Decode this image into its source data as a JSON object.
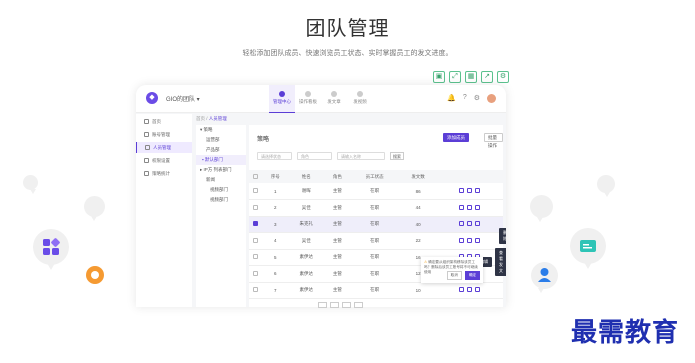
{
  "hero": {
    "title": "团队管理",
    "subtitle": "轻松添加团队成员、快速浏览员工状态、实时掌握员工的发文进度。"
  },
  "toolstrip": [
    "save-icon",
    "expand-icon",
    "grid-icon",
    "share-icon",
    "settings-icon"
  ],
  "app": {
    "org_name": "GIO的团队",
    "tabs": [
      {
        "label": "管理中心",
        "active": true
      },
      {
        "label": "操作看板",
        "active": false
      },
      {
        "label": "发文章",
        "active": false
      },
      {
        "label": "发视频",
        "active": false
      }
    ],
    "sidebar": [
      {
        "label": "首页",
        "active": false
      },
      {
        "label": "账号管理",
        "active": false
      },
      {
        "label": "人员管理",
        "active": true
      },
      {
        "label": "权限设置",
        "active": false
      },
      {
        "label": "策略统计",
        "active": false
      }
    ],
    "breadcrumb": {
      "root": "首页",
      "current": "人员管理"
    },
    "tree": [
      {
        "label": "策略",
        "active": false
      },
      {
        "label": "运营部",
        "active": false
      },
      {
        "label": "产品部",
        "active": false
      },
      {
        "label": "默认部门",
        "active": true
      },
      {
        "label": "IP方 列表部门",
        "active": false
      },
      {
        "label": "新闻",
        "active": false
      },
      {
        "label": "视频部门",
        "active": false
      },
      {
        "label": "视频部门",
        "active": false
      }
    ],
    "main_title": "策略",
    "add_button": "添加成员",
    "more_button": "批量操作",
    "filters": {
      "sel1": "请选择状态",
      "sel2": "角色",
      "search": "请输入名称",
      "search_button": "搜索"
    },
    "columns": [
      "序号",
      "姓名",
      "角色",
      "员工状态",
      "发文数"
    ],
    "rows": [
      {
        "num": "1",
        "name": "谢晖",
        "role": "主管",
        "status": "在职",
        "posts": "86",
        "selected": false
      },
      {
        "num": "2",
        "name": "吴佳",
        "role": "主管",
        "status": "在职",
        "posts": "44",
        "selected": false
      },
      {
        "num": "3",
        "name": "朱克礼",
        "role": "主管",
        "status": "在职",
        "posts": "40",
        "selected": true
      },
      {
        "num": "4",
        "name": "吴佳",
        "role": "主管",
        "status": "在职",
        "posts": "22",
        "selected": false
      },
      {
        "num": "5",
        "name": "素伊达",
        "role": "主管",
        "status": "在职",
        "posts": "16",
        "selected": false
      },
      {
        "num": "6",
        "name": "素伊达",
        "role": "主管",
        "status": "在职",
        "posts": "12",
        "selected": false
      },
      {
        "num": "7",
        "name": "素伊达",
        "role": "主管",
        "status": "在职",
        "posts": "10",
        "selected": false
      }
    ],
    "tooltips": {
      "t1": "编辑",
      "t2": "删除",
      "t3": "查看发文"
    },
    "confirm": {
      "text": "确定要从组织架构移除该员工吗？删除后该员工账号将不可继续使用",
      "cancel": "取消",
      "ok": "确定"
    }
  },
  "watermark": "最需教育"
}
